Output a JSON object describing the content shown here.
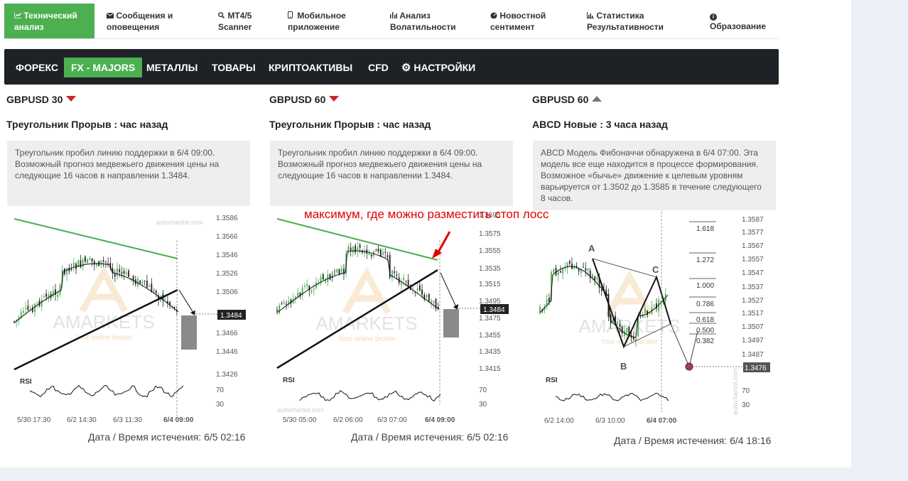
{
  "top_nav": [
    {
      "icon": "chart-line-icon",
      "line1": "Технический",
      "line2": "анализ",
      "active": true
    },
    {
      "icon": "envelope-icon",
      "line1": "Сообщения и",
      "line2": "оповещения"
    },
    {
      "icon": "scanner-icon",
      "line1": "MT4/5",
      "line2": "Scanner"
    },
    {
      "icon": "mobile-icon",
      "line1": "Мобильное",
      "line2": "приложение"
    },
    {
      "icon": "volatility-icon",
      "line1": "Анализ",
      "line2": "Волатильности"
    },
    {
      "icon": "gauge-icon",
      "line1": "Новостной",
      "line2": "сентимент"
    },
    {
      "icon": "stats-icon",
      "line1": "Статистика",
      "line2": "Результативности"
    },
    {
      "icon": "info-icon",
      "line1": "Образование",
      "line2": ""
    }
  ],
  "categories": [
    "ФОРЕКС",
    "FX - MAJORS",
    "МЕТАЛЛЫ",
    "ТОВАРЫ",
    "КРИПТОАКТИВЫ",
    "CFD",
    "НАСТРОЙКИ"
  ],
  "active_category": "FX - MAJORS",
  "annotation": "максимум, где можно разместить стоп лосс",
  "cards": [
    {
      "symbol": "GBPUSD 30",
      "direction": "down",
      "title": "Треугольник Прорыв : час назад",
      "description": "Треугольник пробил линию поддержки в 6/4 09:00. Возможный прогноз медвежьего движения цены на следующие 16 часов в направлении 1.3484.",
      "price_ticks": [
        "1.3586",
        "1.3566",
        "1.3546",
        "1.3526",
        "1.3506",
        "1.3466",
        "1.3446",
        "1.3426"
      ],
      "target": "1.3484",
      "time_ticks": [
        "5/30 17:30",
        "6/2 14:30",
        "6/3 11:30",
        "6/4 09:00"
      ],
      "rsi_label": "RSI",
      "rsi_ticks": [
        "70",
        "30"
      ],
      "watermark": "autochartist.com",
      "brand": "AMARKETS",
      "brand_sub": "Your online broker",
      "expiry": "Дата / Время истечения: 6/5 02:16"
    },
    {
      "symbol": "GBPUSD 60",
      "direction": "down",
      "title": "Треугольник Прорыв : час назад",
      "description": "Треугольник пробил линию поддержки в 6/4 09:00. Возможный прогноз медвежьего движения цены на следующие 16 часов в направлении 1.3484.",
      "price_ticks": [
        "1.3595",
        "1.3575",
        "1.3555",
        "1.3535",
        "1.3515",
        "1.3495",
        "1.3475",
        "1.3455",
        "1.3435",
        "1.3415"
      ],
      "target": "1.3484",
      "time_ticks": [
        "5/30 05:00",
        "6/2 06:00",
        "6/3 07:00",
        "6/4 09:00"
      ],
      "rsi_label": "RSI",
      "rsi_ticks": [
        "70",
        "30"
      ],
      "watermark": "autochartist.com",
      "brand": "AMARKETS",
      "brand_sub": "Your online broker",
      "expiry": "Дата / Время истечения: 6/5 02:16"
    },
    {
      "symbol": "GBPUSD 60",
      "direction": "up",
      "title": "ABCD Новые : 3 часа назад",
      "description": "ABCD Модель Фибоначчи обнаружена в 6/4 07:00. Эта модель все еще находится в процессе формирования. Возможное «бычье» движение к целевым уровням варьируется от 1.3502 до 1.3585 в течение следующего 8 часов.",
      "price_ticks": [
        "1.3587",
        "1.3577",
        "1.3567",
        "1.3557",
        "1.3547",
        "1.3537",
        "1.3527",
        "1.3517",
        "1.3507",
        "1.3497",
        "1.3487"
      ],
      "target": "1.3476",
      "fib_levels": [
        "1.618",
        "1.272",
        "1.000",
        "0.786",
        "0.618",
        "0.500",
        "0.382"
      ],
      "points": [
        "A",
        "B",
        "C"
      ],
      "time_ticks": [
        "6/2 14:00",
        "6/3 10:00",
        "6/4 07:00"
      ],
      "rsi_label": "RSI",
      "rsi_ticks": [
        "70",
        "30"
      ],
      "watermark": "autochartist.com",
      "brand": "AMARKETS",
      "brand_sub": "Your online broker",
      "expiry": "Дата / Время истечения: 6/4 18:16"
    }
  ],
  "colors": {
    "accent": "#4caf50",
    "bearish": "#c62828",
    "dark_bar": "#1e2125",
    "annotation": "#e00000"
  }
}
